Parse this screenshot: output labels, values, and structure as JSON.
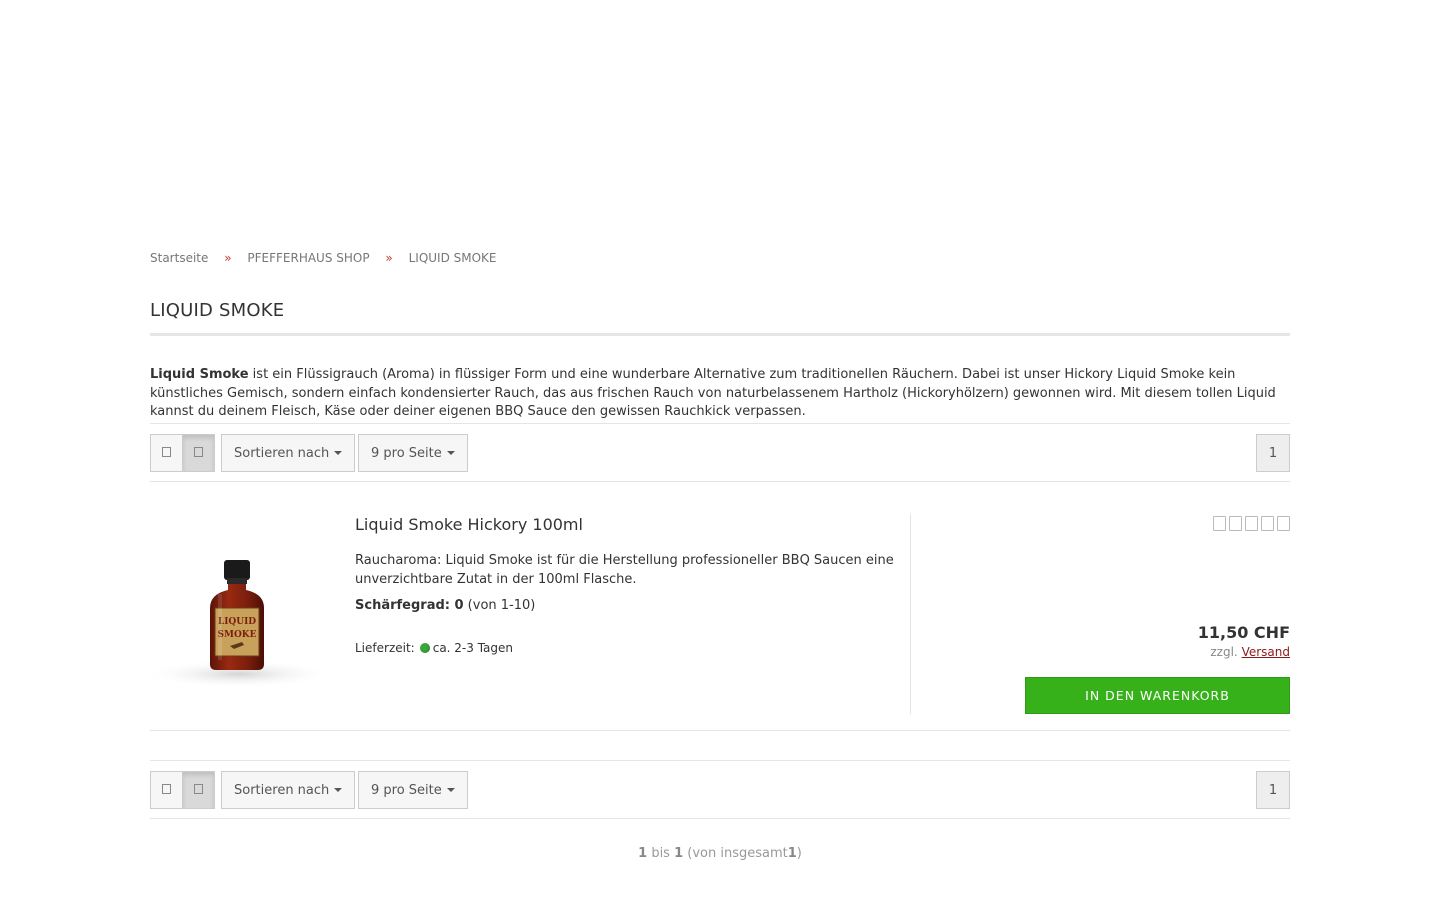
{
  "breadcrumb": {
    "items": [
      "Startseite",
      "PFEFFERHAUS SHOP",
      "LIQUID SMOKE"
    ],
    "separator": "»"
  },
  "category": {
    "title": "LIQUID SMOKE",
    "description_bold": "Liquid Smoke",
    "description_rest": " ist ein Flüssigrauch (Aroma) in flüssiger Form und eine wunderbare Alternative zum traditionellen Räuchern. Dabei ist unser Hickory Liquid Smoke kein künstliches Gemisch, sondern einfach kondensierter Rauch, das aus frischen Rauch von naturbelassenem Hartholz (Hickoryhölzern) gewonnen wird. Mit diesem tollen Liquid kannst du deinem Fleisch, Käse oder deiner eigenen BBQ Sauce den gewissen Rauchkick verpassen."
  },
  "toolbar": {
    "view_grid_icon": "grid-icon",
    "view_list_icon": "list-icon",
    "sort_label": "Sortieren nach",
    "per_page_label": "9 pro Seite",
    "current_page": "1"
  },
  "product": {
    "name": "Liquid Smoke Hickory 100ml",
    "short_description": "Raucharoma: Liquid Smoke ist für die Herstellung professioneller BBQ Saucen eine unverzichtbare Zutat in der 100ml Flasche.",
    "heat_label": "Schärfegrad: 0",
    "heat_range": " (von 1-10)",
    "delivery_label": "Lieferzeit:",
    "delivery_value": "ca. 2-3 Tagen",
    "delivery_status_color": "#3aa83a",
    "rating": 0,
    "rating_max": 5,
    "price": "11,50 CHF",
    "shipping_prefix": "zzgl.",
    "shipping_link": "Versand",
    "cart_button": "IN DEN WARENKORB",
    "image_label_line1": "LIQUID",
    "image_label_line2": "SMOKE"
  },
  "pagination_summary": {
    "from": "1",
    "word_to": "bis",
    "to": "1",
    "total_prefix": "(von insgesamt",
    "total": "1",
    "total_suffix": ")"
  },
  "colors": {
    "accent_separator": "#c0392b",
    "cart_button": "#36b11a",
    "shipping_link": "#8b1a1a"
  }
}
